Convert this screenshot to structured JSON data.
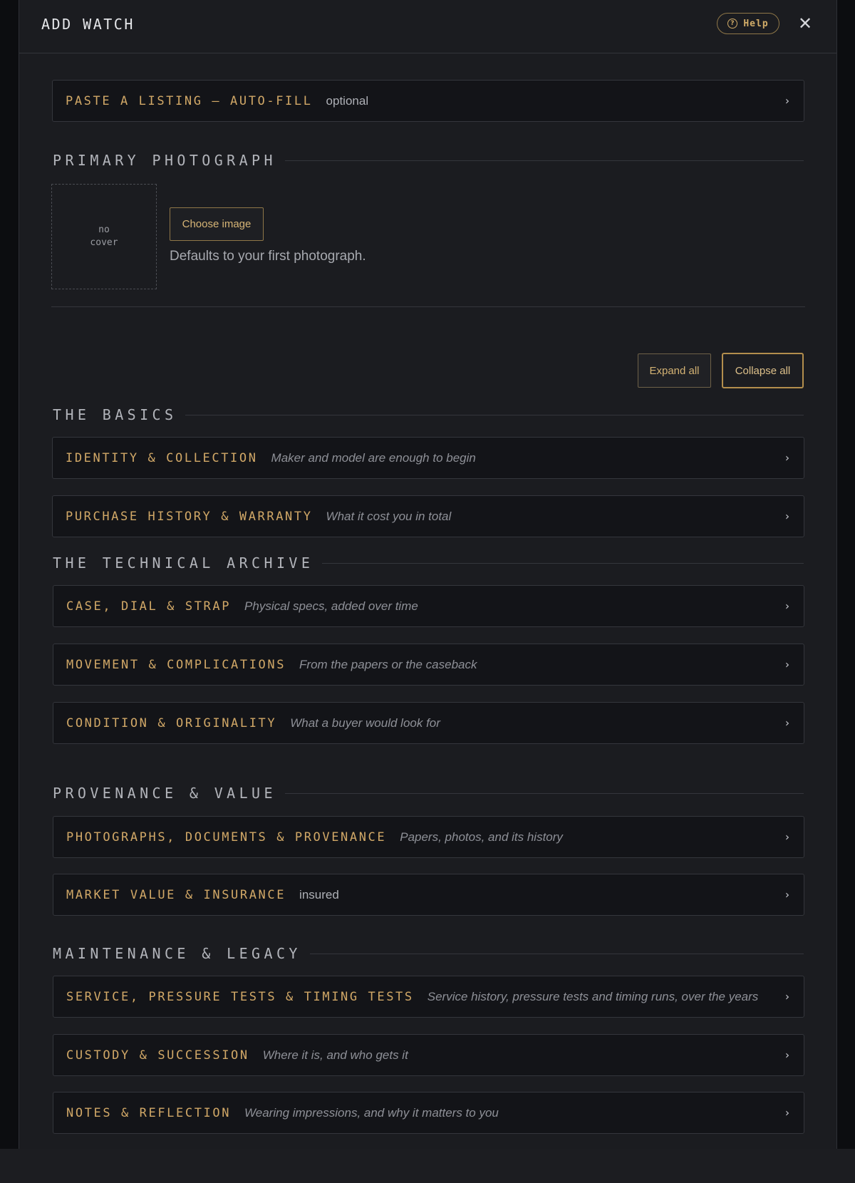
{
  "header": {
    "title": "ADD WATCH",
    "help_label": "Help",
    "close_glyph": "✕"
  },
  "autofill": {
    "title": "PASTE A LISTING — AUTO-FILL",
    "hint": "optional"
  },
  "photo": {
    "section_title": "PRIMARY PHOTOGRAPH",
    "placeholder_line1": "no",
    "placeholder_line2": "cover",
    "choose_label": "Choose image",
    "hint": "Defaults to your first photograph."
  },
  "controls": {
    "expand_label": "Expand all",
    "collapse_label": "Collapse all"
  },
  "sections": [
    {
      "title": "THE BASICS",
      "items": [
        {
          "title": "IDENTITY & COLLECTION",
          "subtitle": "Maker and model are enough to begin"
        },
        {
          "title": "PURCHASE HISTORY & WARRANTY",
          "subtitle": "What it cost you in total"
        }
      ]
    },
    {
      "title": "THE TECHNICAL ARCHIVE",
      "items": [
        {
          "title": "CASE, DIAL & STRAP",
          "subtitle": "Physical specs, added over time"
        },
        {
          "title": "MOVEMENT & COMPLICATIONS",
          "subtitle": "From the papers or the caseback"
        },
        {
          "title": "CONDITION & ORIGINALITY",
          "subtitle": "What a buyer would look for"
        }
      ]
    },
    {
      "title": "PROVENANCE & VALUE",
      "items": [
        {
          "title": "PHOTOGRAPHS, DOCUMENTS & PROVENANCE",
          "subtitle": "Papers, photos, and its history"
        },
        {
          "title": "MARKET VALUE & INSURANCE",
          "subtitle": "insured"
        }
      ]
    },
    {
      "title": "MAINTENANCE & LEGACY",
      "items": [
        {
          "title": "SERVICE, PRESSURE TESTS & TIMING TESTS",
          "subtitle": "Service history, pressure tests and timing runs, over the years"
        },
        {
          "title": "CUSTODY & SUCCESSION",
          "subtitle": "Where it is, and who gets it"
        },
        {
          "title": "NOTES & REFLECTION",
          "subtitle": "Wearing impressions, and why it matters to you"
        }
      ]
    }
  ],
  "chevron_glyph": "›",
  "colors": {
    "accent": "#d1a867",
    "background": "#1b1c20",
    "row_background": "#131418",
    "border": "#34363c"
  }
}
